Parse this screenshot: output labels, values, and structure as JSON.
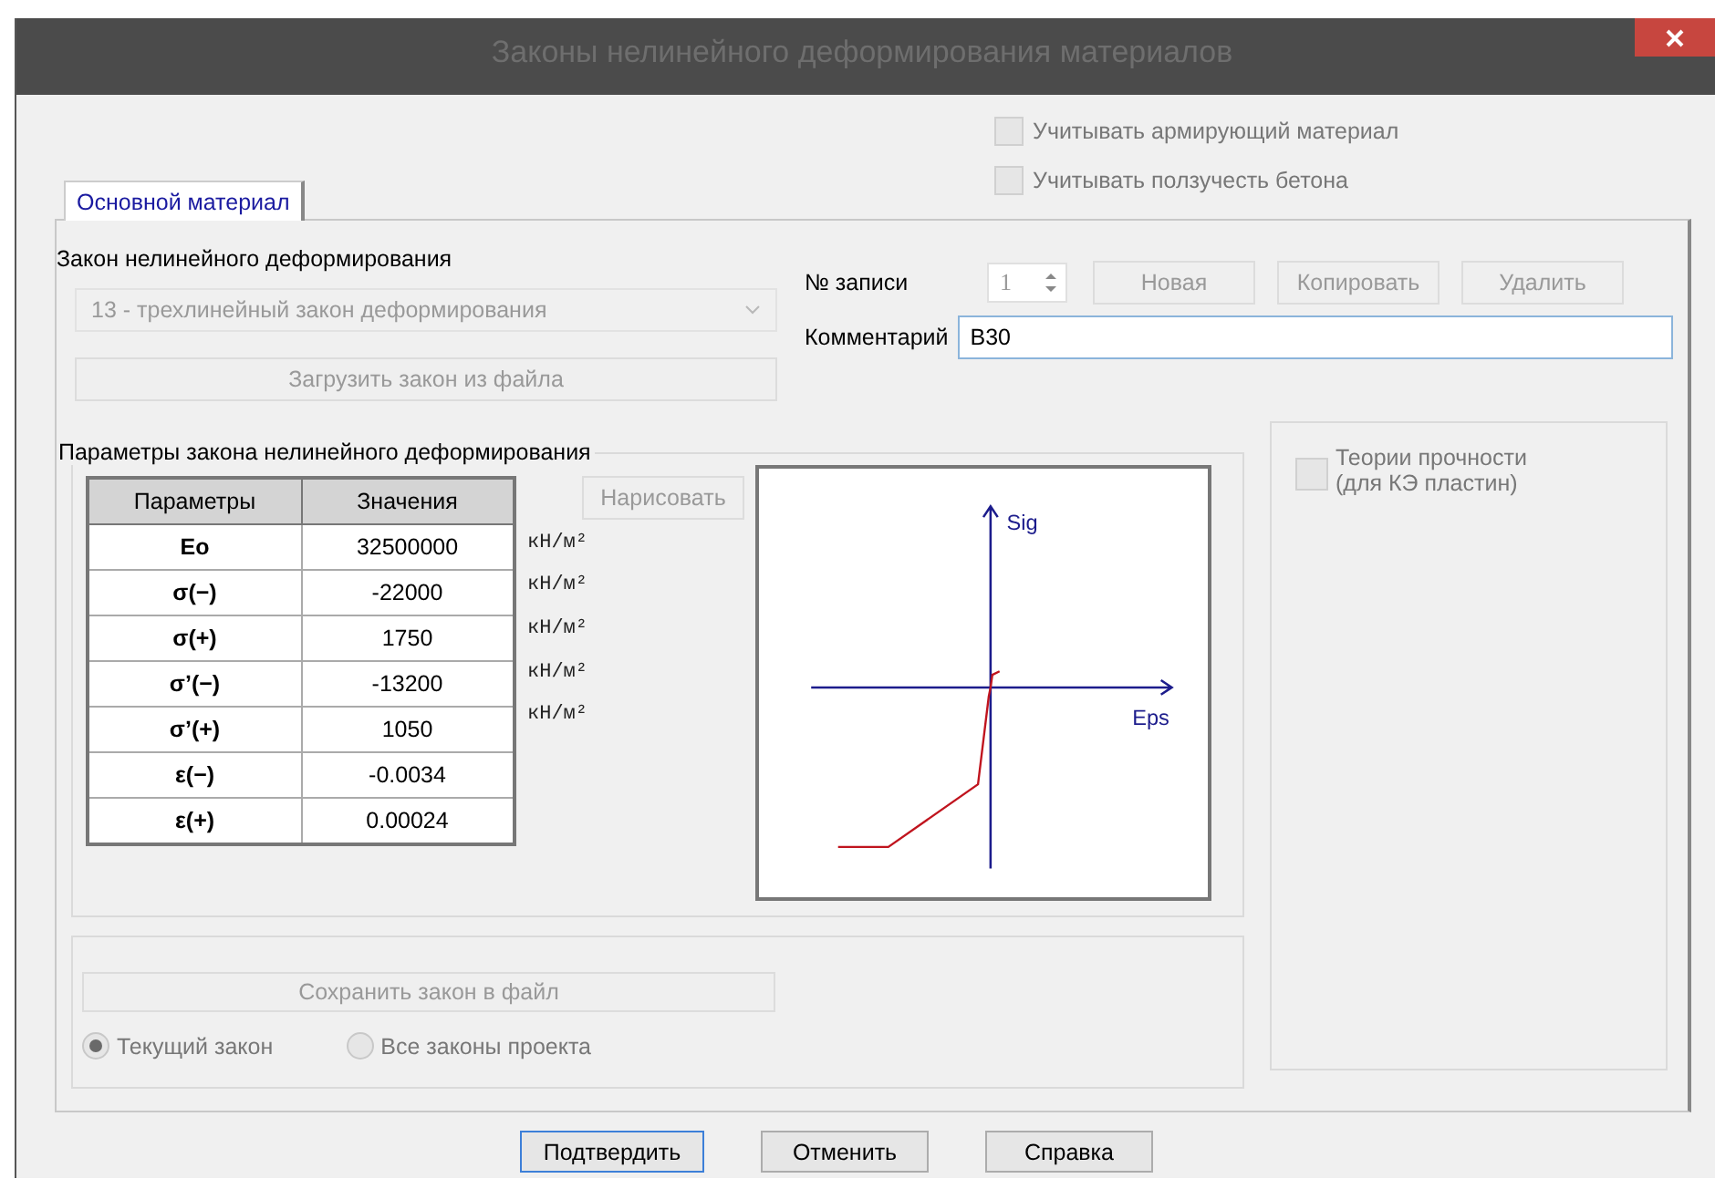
{
  "window": {
    "title": "Законы нелинейного деформирования материалов"
  },
  "options": [
    {
      "label": "Учитывать армирующий материал",
      "checked": false,
      "disabled": true
    },
    {
      "label": "Учитывать ползучесть бетона",
      "checked": false,
      "disabled": true
    }
  ],
  "tabs": [
    {
      "label": "Основной материал",
      "selected": true
    }
  ],
  "law": {
    "label": "Закон нелинейного деформирования",
    "value": "13 - трехлинейный закон деформирования",
    "disabled": true,
    "load_button": {
      "label": "Загрузить закон из файла",
      "disabled": true
    }
  },
  "record": {
    "label": "№ записи",
    "number": "1",
    "buttons": [
      {
        "label": "Новая",
        "disabled": true
      },
      {
        "label": "Копировать",
        "disabled": true
      },
      {
        "label": "Удалить",
        "disabled": true
      }
    ],
    "comment_label": "Комментарий",
    "comment": "B30"
  },
  "parameters": {
    "title": "Параметры закона нелинейного деформирования",
    "columns": [
      "Параметры",
      "Значения"
    ],
    "rows": [
      {
        "name": "Eo",
        "value": "32500000",
        "unit": "кН/м²"
      },
      {
        "name": "σ(−)",
        "value": "-22000",
        "unit": "кН/м²"
      },
      {
        "name": "σ(+)",
        "value": "1750",
        "unit": "кН/м²"
      },
      {
        "name": "σ’(−)",
        "value": "-13200",
        "unit": "кН/м²"
      },
      {
        "name": "σ’(+)",
        "value": "1050",
        "unit": "кН/м²"
      },
      {
        "name": "ε(−)",
        "value": "-0.0034"
      },
      {
        "name": "ε(+)",
        "value": "0.00024"
      }
    ],
    "draw_button": {
      "label": "Нарисовать",
      "disabled": true
    },
    "plot": {
      "y_axis": "Sig",
      "x_axis": "Eps"
    }
  },
  "strength": {
    "label": "Теории прочности (для КЭ пластин)",
    "checked": false,
    "disabled": true
  },
  "save": {
    "button": {
      "label": "Сохранить закон в файл",
      "disabled": true
    },
    "scope": [
      {
        "label": "Текущий закон",
        "selected": true
      },
      {
        "label": "Все законы проекта",
        "selected": false
      }
    ]
  },
  "buttons": [
    {
      "label": "Подтвердить",
      "focused": true
    },
    {
      "label": "Отменить",
      "focused": false
    },
    {
      "label": "Справка",
      "focused": false
    }
  ]
}
